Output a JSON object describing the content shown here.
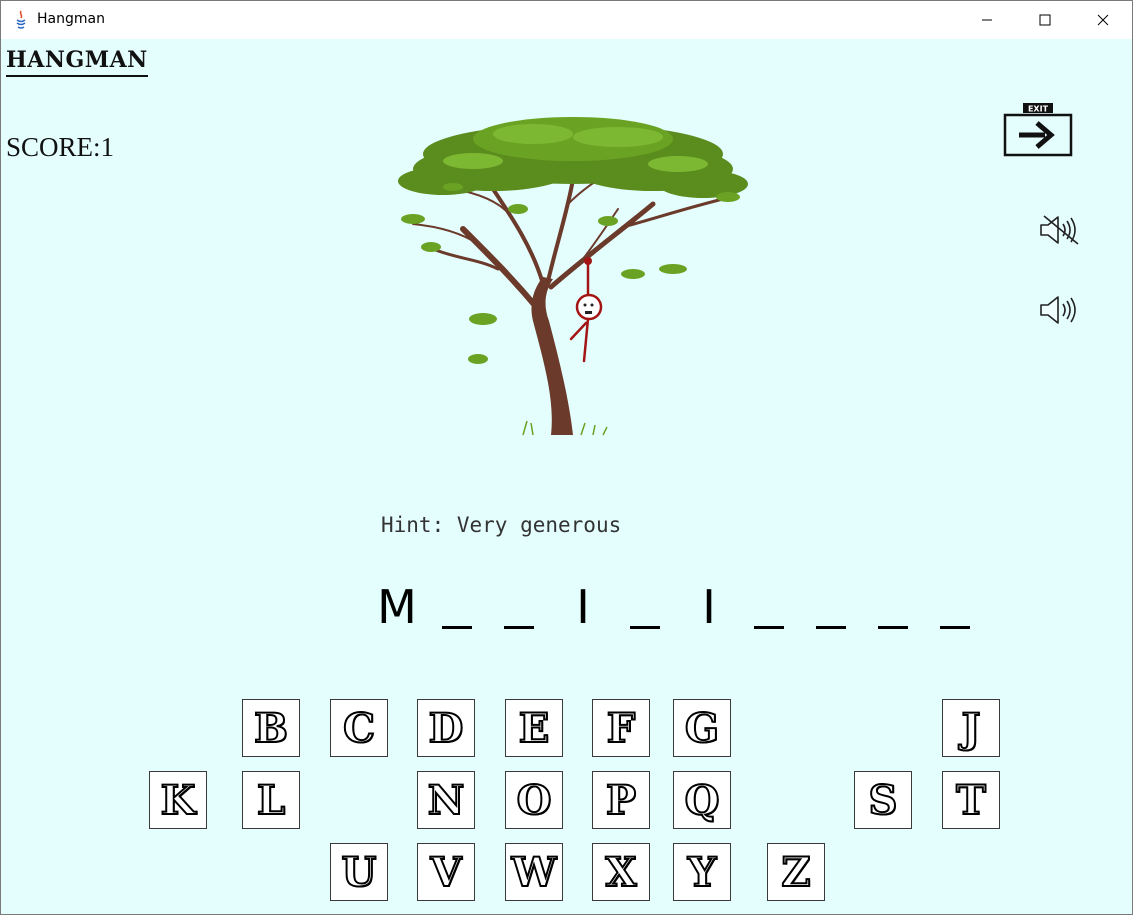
{
  "window": {
    "title": "Hangman"
  },
  "game": {
    "title": "HANGMAN",
    "score_label": "SCORE:",
    "score_value": "1",
    "hint_label": "Hint:",
    "hint_text": "Very generous"
  },
  "word_slots": [
    "M",
    "",
    "",
    "I",
    "",
    "I",
    "",
    "",
    "",
    ""
  ],
  "keyboard": {
    "row1": [
      "B",
      "C",
      "D",
      "E",
      "F",
      "G",
      "J"
    ],
    "row2": [
      "K",
      "L",
      "N",
      "O",
      "P",
      "Q",
      "S",
      "T"
    ],
    "row3": [
      "U",
      "V",
      "W",
      "X",
      "Y",
      "Z"
    ]
  },
  "icons": {
    "exit": "exit-arrow-icon",
    "mute": "speaker-muted-icon",
    "sound": "speaker-on-icon"
  },
  "colors": {
    "background": "#e4fefe",
    "rope": "#a31515",
    "leaves": "#5b8c1e",
    "trunk": "#6b3a2a"
  }
}
